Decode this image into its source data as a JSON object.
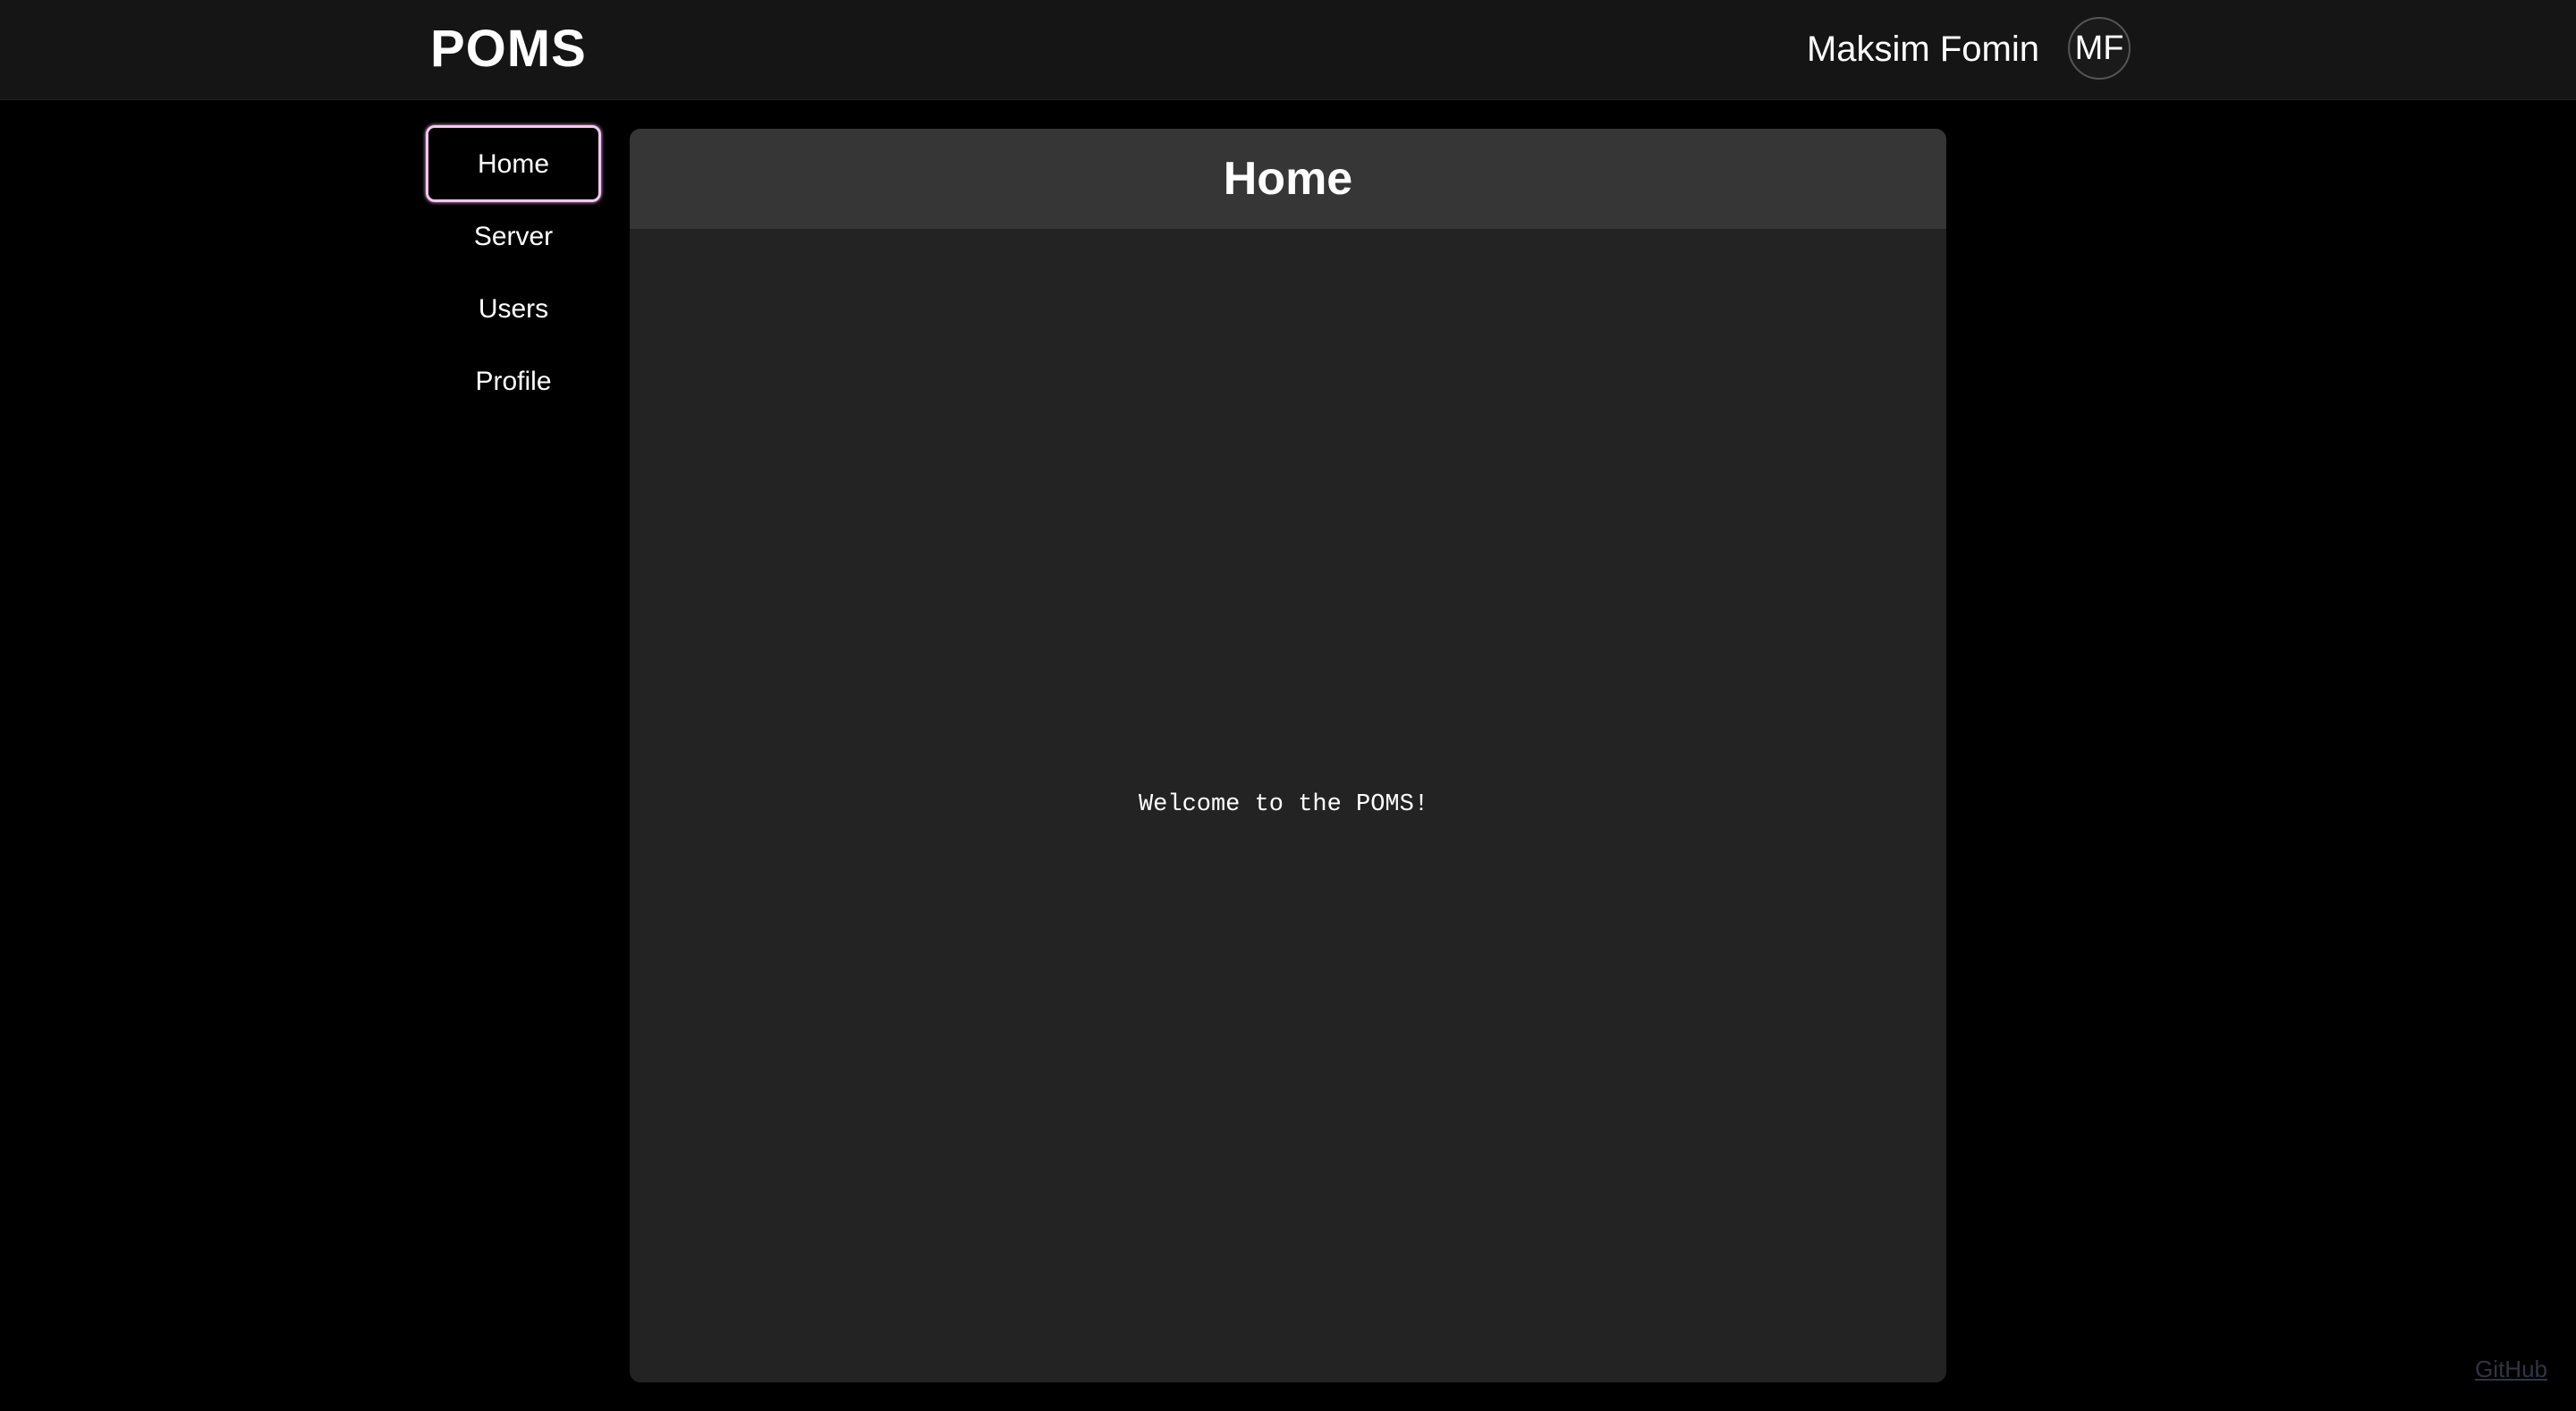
{
  "header": {
    "brand": "POMS",
    "user_name": "Maksim Fomin",
    "avatar_initials": "MF"
  },
  "sidebar": {
    "items": [
      {
        "label": "Home",
        "active": true
      },
      {
        "label": "Server",
        "active": false
      },
      {
        "label": "Users",
        "active": false
      },
      {
        "label": "Profile",
        "active": false
      }
    ]
  },
  "main": {
    "title": "Home",
    "welcome": "Welcome to the POMS!"
  },
  "footer": {
    "github_label": "GitHub"
  },
  "colors": {
    "background": "#000000",
    "topbar": "#151515",
    "panel": "#232323",
    "panel_header": "#363636",
    "active_nav_border": "#f4c8f2"
  }
}
